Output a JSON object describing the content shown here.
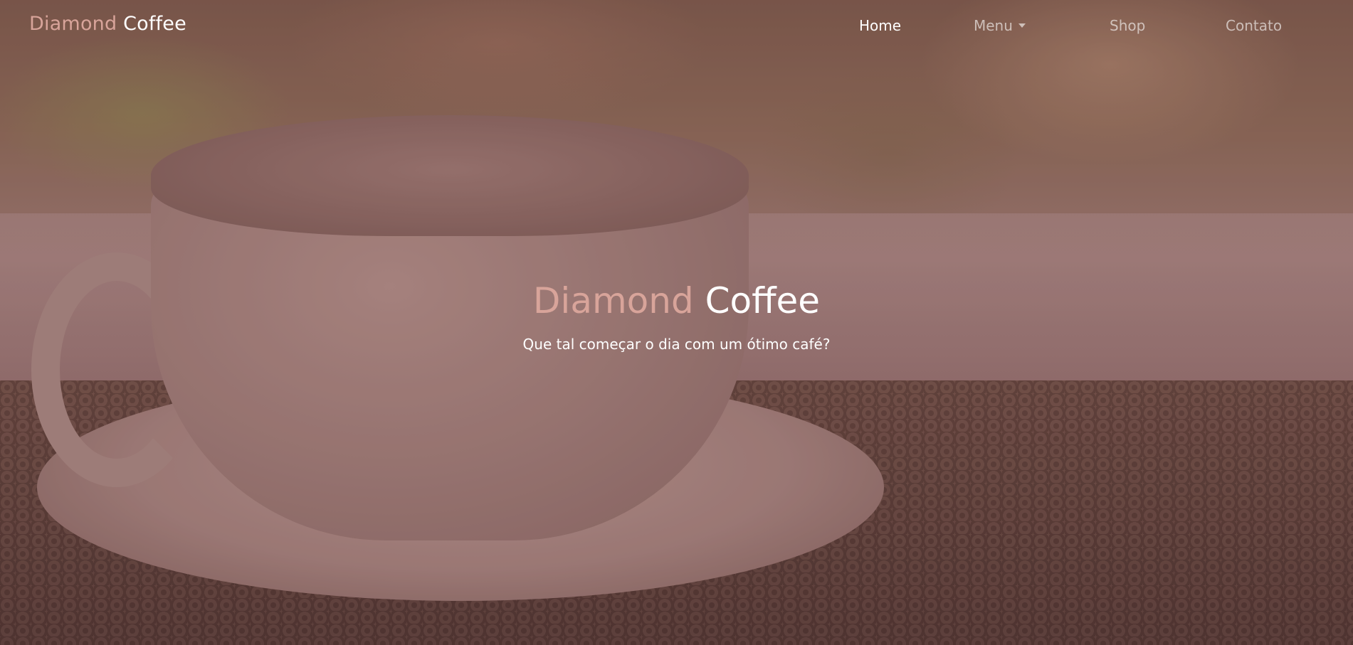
{
  "navbar": {
    "brand_accent": "Diamond",
    "brand_main": "Coffee",
    "links": [
      {
        "label": "Home",
        "active": true
      },
      {
        "label": "Menu",
        "dropdown": true
      },
      {
        "label": "Shop"
      },
      {
        "label": "Contato"
      }
    ]
  },
  "hero": {
    "title_accent": "Diamond",
    "title_main": "Coffee",
    "subtitle": "Que tal começar o dia com um ótimo café?"
  },
  "colors": {
    "accent": "#d8a49a",
    "text": "#ffffff",
    "overlay": "#6e3c3c"
  },
  "icons": {
    "menu_dropdown": "caret-down-icon"
  }
}
